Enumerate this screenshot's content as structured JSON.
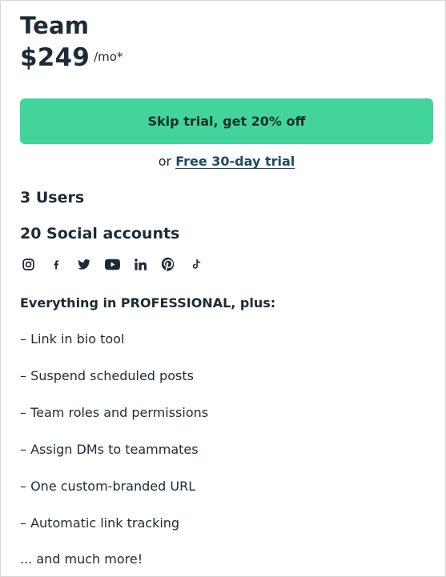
{
  "plan": {
    "name": "Team",
    "price": "$249",
    "price_suffix": "/mo*"
  },
  "cta": {
    "button_label": "Skip trial, get 20% off",
    "trial_prefix": "or",
    "trial_link": "Free 30-day trial"
  },
  "limits": {
    "users": "3 Users",
    "social_accounts": "20 Social accounts"
  },
  "social_networks": [
    {
      "icon": "instagram-icon"
    },
    {
      "icon": "facebook-icon"
    },
    {
      "icon": "twitter-icon"
    },
    {
      "icon": "youtube-icon"
    },
    {
      "icon": "linkedin-icon"
    },
    {
      "icon": "pinterest-icon"
    },
    {
      "icon": "tiktok-icon"
    }
  ],
  "features": {
    "heading": "Everything in PROFESSIONAL, plus:",
    "items": [
      "– Link in bio tool",
      "– Suspend scheduled posts",
      "– Team roles and permissions",
      "– Assign DMs to teammates",
      "– One custom-branded URL",
      "– Automatic link tracking"
    ],
    "more": "... and much more!"
  },
  "colors": {
    "accent": "#43d49c",
    "text": "#1c2b36",
    "link": "#1c4a63"
  }
}
